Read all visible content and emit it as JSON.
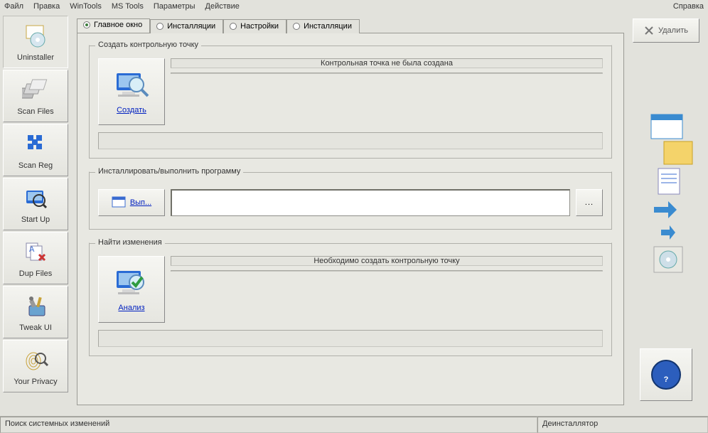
{
  "menubar": {
    "items": [
      "Файл",
      "Правка",
      "WinTools",
      "MS Tools",
      "Параметры",
      "Действие"
    ],
    "help": "Справка"
  },
  "sidebar": [
    {
      "label": "Uninstaller"
    },
    {
      "label": "Scan Files"
    },
    {
      "label": "Scan Reg"
    },
    {
      "label": "Start Up"
    },
    {
      "label": "Dup Files"
    },
    {
      "label": "Tweak UI"
    },
    {
      "label": "Your Privacy"
    }
  ],
  "tabs": [
    {
      "label": "Главное окно",
      "active": true
    },
    {
      "label": "Инсталляции",
      "active": false
    },
    {
      "label": "Настройки",
      "active": false
    },
    {
      "label": "Инсталляции",
      "active": false
    }
  ],
  "group_create": {
    "title": "Создать контрольную точку",
    "button": "Создать",
    "status": "Контрольная точка не была создана"
  },
  "group_install": {
    "title": "Инсталлировать/выполнить программу",
    "button": "Вып...",
    "path_value": "",
    "path_placeholder": "",
    "browse": "..."
  },
  "group_find": {
    "title": "Найти изменения",
    "button": "Анализ",
    "status": "Необходимо создать контрольную точку"
  },
  "right": {
    "delete": "Удалить"
  },
  "status": {
    "left": "Поиск системных изменений",
    "right": "Деинсталлятор"
  }
}
